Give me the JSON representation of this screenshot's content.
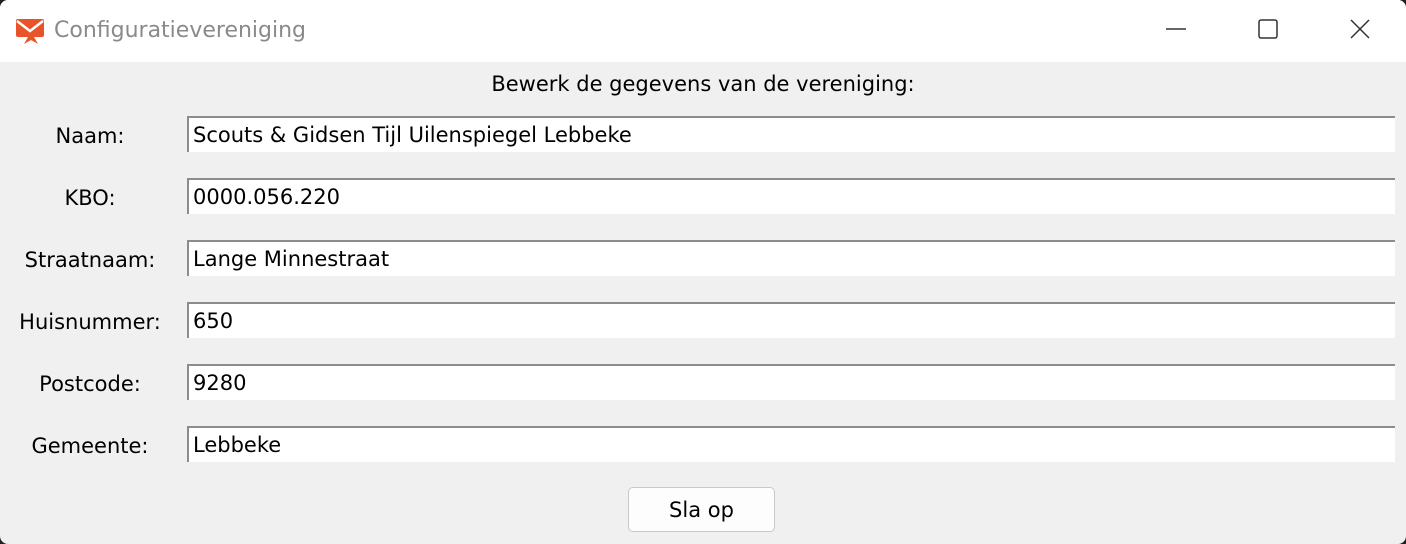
{
  "window": {
    "title": "Configuratievereniging",
    "app_icon": "envelope-icon",
    "controls": [
      "minimize-icon",
      "maximize-icon",
      "close-icon"
    ],
    "accent_color": "#e8542a"
  },
  "form": {
    "heading": "Bewerk de gegevens van de vereniging:",
    "fields": [
      {
        "label": "Naam:",
        "value": "Scouts & Gidsen Tijl Uilenspiegel Lebbeke"
      },
      {
        "label": "KBO:",
        "value": "0000.056.220"
      },
      {
        "label": "Straatnaam:",
        "value": "Lange Minnestraat"
      },
      {
        "label": "Huisnummer:",
        "value": "650"
      },
      {
        "label": "Postcode:",
        "value": "9280"
      },
      {
        "label": "Gemeente:",
        "value": "Lebbeke"
      }
    ],
    "save_label": "Sla op"
  }
}
